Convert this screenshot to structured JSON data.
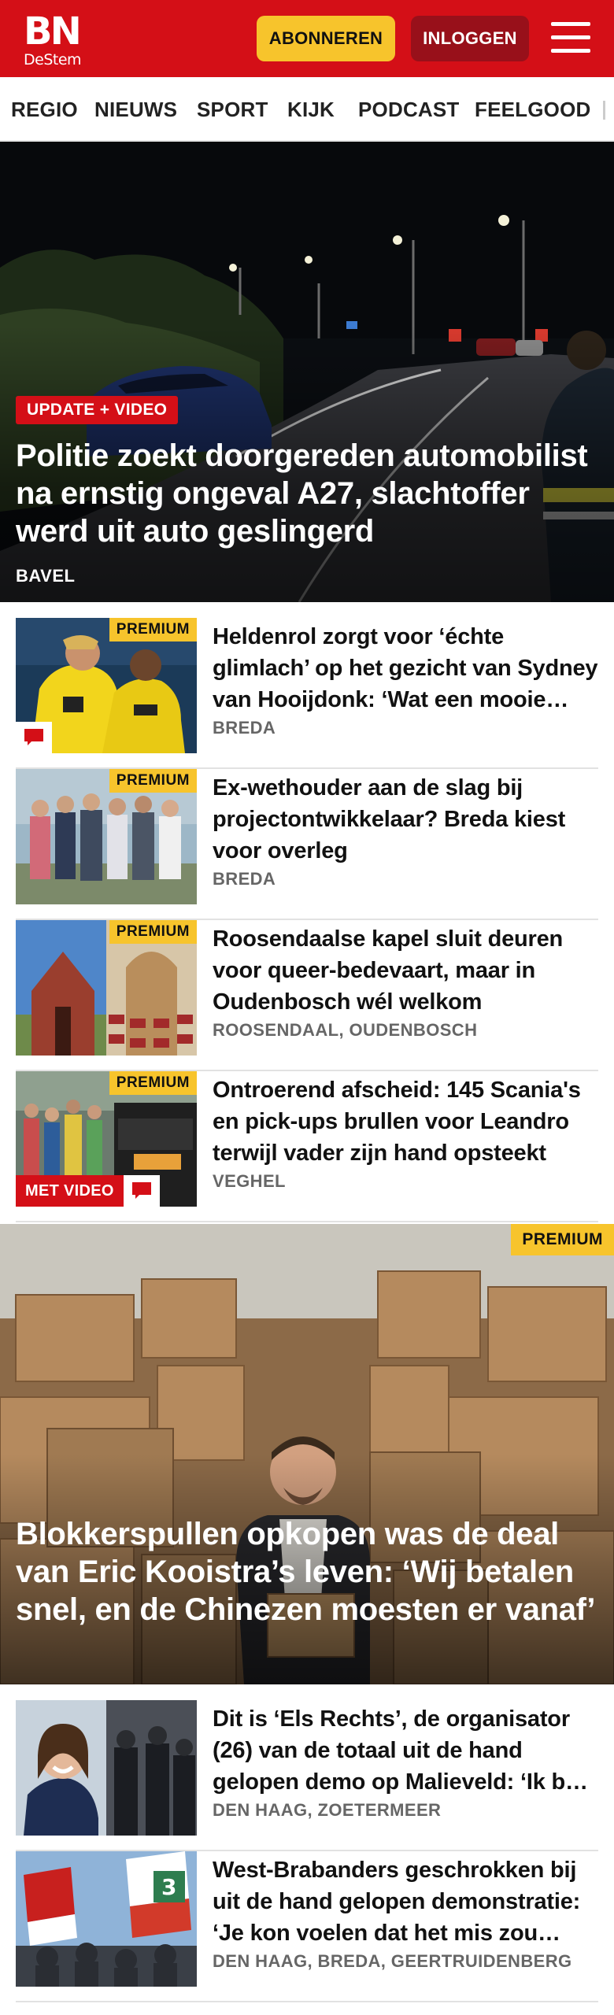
{
  "header": {
    "logo_main": "BN",
    "logo_sub": "DeStem",
    "subscribe_label": "ABONNEREN",
    "login_label": "INLOGGEN",
    "menu_icon": "hamburger-menu-icon",
    "brand_color": "#d40f17",
    "subscribe_color": "#f7c42c",
    "login_color": "#98101a"
  },
  "nav": {
    "items": [
      "REGIO",
      "NIEUWS",
      "SPORT",
      "KIJK",
      "PODCAST",
      "FEELGOOD"
    ]
  },
  "hero": {
    "badge": "UPDATE + VIDEO",
    "title": "Politie zoekt doorgereden automobi­list na ernstig ongeval A27, slachtof­fer werd uit auto geslingerd",
    "location": "BAVEL"
  },
  "articles": [
    {
      "premium": "PREMIUM",
      "title": "Heldenrol zorgt voor ‘échte glimlach’ op het gezicht van Sydney van Hooijdonk: ‘Wat een mooie avond’",
      "location": "BREDA",
      "has_comments": true
    },
    {
      "premium": "PREMIUM",
      "title": "Ex-wethouder aan de slag bij projectontwikkelaar? Breda kiest voor overleg",
      "location": "BREDA"
    },
    {
      "premium": "PREMIUM",
      "title": "Roosendaalse kapel sluit deuren voor queer-bedevaart, maar in Oudenbosch wél welkom",
      "location": "ROOSENDAAL, OUDENBOSCH"
    },
    {
      "premium": "PREMIUM",
      "title": "Ontroerend afscheid: 145 Scania's en pick-ups brullen voor Leandro terwijl vader zijn hand opsteekt",
      "location": "VEGHEL",
      "video_badge": "MET VIDEO",
      "has_comments": true
    }
  ],
  "feature": {
    "premium": "PREMIUM",
    "title": "Blokkerspullen opkopen was de deal van Eric Kooistra’s leven: ‘Wij betalen snel, en de Chinezen moesten er vanaf’"
  },
  "more_articles": [
    {
      "title": "Dit is ‘Els Rechts’, de organisator (26) van de totaal uit de hand gelopen demo op Malieveld: ‘Ik ben geschrokken’",
      "location": "DEN HAAG, ZOETERMEER"
    },
    {
      "title": "West-Brabanders geschrokken bij uit de hand gelopen demonstratie: ‘Je kon voelen dat het mis zou gaan’",
      "location": "DEN HAAG, BREDA, GEERTRUIDENBERG"
    }
  ]
}
